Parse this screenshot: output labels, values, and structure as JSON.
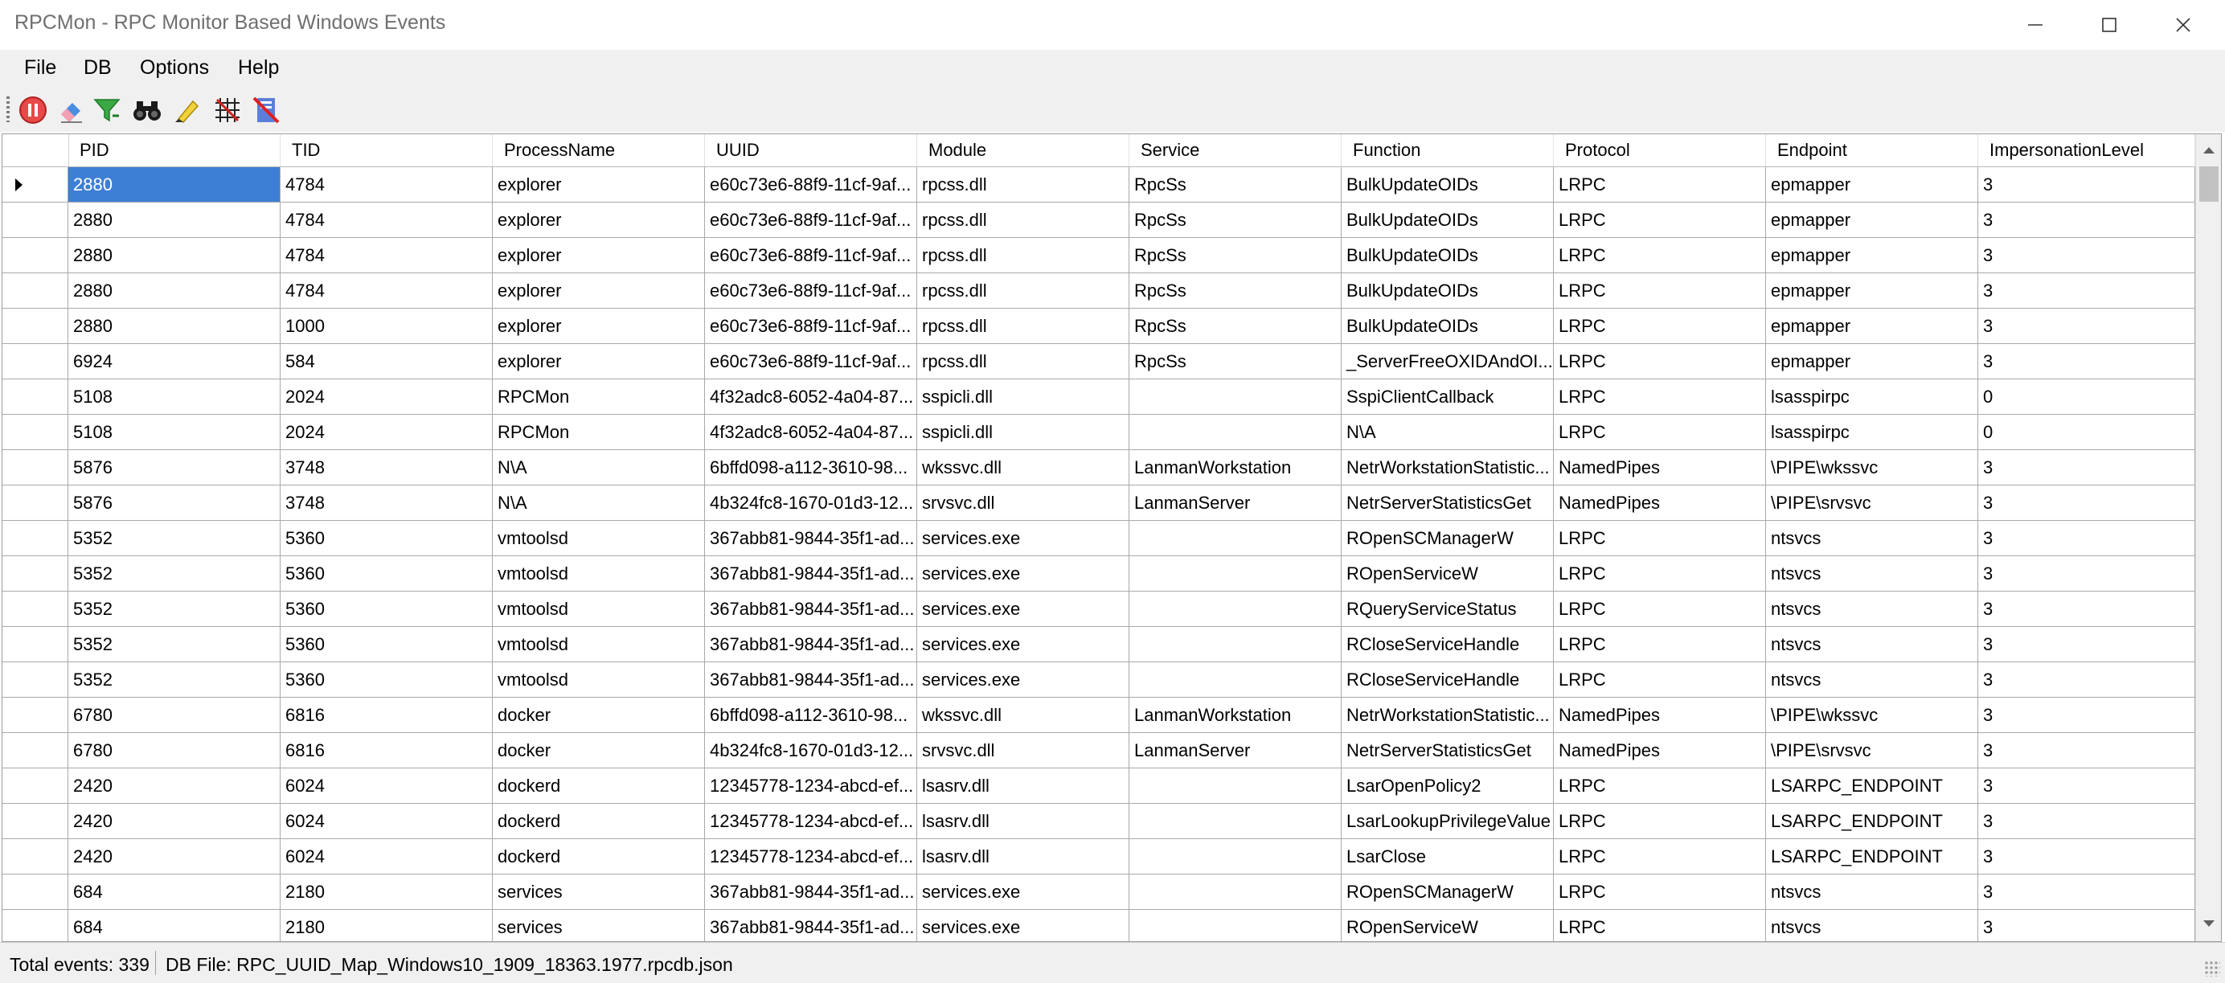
{
  "window": {
    "title": "RPCMon - RPC Monitor Based Windows Events"
  },
  "menu": [
    "File",
    "DB",
    "Options",
    "Help"
  ],
  "toolbar": [
    "stop-icon",
    "eraser-icon",
    "filter-icon",
    "binoculars-icon",
    "highlighter-icon",
    "grid-icon",
    "clear-filter-icon"
  ],
  "grid": {
    "columns": [
      "PID",
      "TID",
      "ProcessName",
      "UUID",
      "Module",
      "Service",
      "Function",
      "Protocol",
      "Endpoint",
      "ImpersonationLevel"
    ],
    "selected_row": 0,
    "rows": [
      [
        "2880",
        "4784",
        "explorer",
        "e60c73e6-88f9-11cf-9af...",
        "rpcss.dll",
        "RpcSs",
        "BulkUpdateOIDs",
        "LRPC",
        "epmapper",
        "3"
      ],
      [
        "2880",
        "4784",
        "explorer",
        "e60c73e6-88f9-11cf-9af...",
        "rpcss.dll",
        "RpcSs",
        "BulkUpdateOIDs",
        "LRPC",
        "epmapper",
        "3"
      ],
      [
        "2880",
        "4784",
        "explorer",
        "e60c73e6-88f9-11cf-9af...",
        "rpcss.dll",
        "RpcSs",
        "BulkUpdateOIDs",
        "LRPC",
        "epmapper",
        "3"
      ],
      [
        "2880",
        "4784",
        "explorer",
        "e60c73e6-88f9-11cf-9af...",
        "rpcss.dll",
        "RpcSs",
        "BulkUpdateOIDs",
        "LRPC",
        "epmapper",
        "3"
      ],
      [
        "2880",
        "1000",
        "explorer",
        "e60c73e6-88f9-11cf-9af...",
        "rpcss.dll",
        "RpcSs",
        "BulkUpdateOIDs",
        "LRPC",
        "epmapper",
        "3"
      ],
      [
        "6924",
        "584",
        "explorer",
        "e60c73e6-88f9-11cf-9af...",
        "rpcss.dll",
        "RpcSs",
        "_ServerFreeOXIDAndOI...",
        "LRPC",
        "epmapper",
        "3"
      ],
      [
        "5108",
        "2024",
        "RPCMon",
        "4f32adc8-6052-4a04-87...",
        "sspicli.dll",
        "",
        "SspiClientCallback",
        "LRPC",
        "lsasspirpc",
        "0"
      ],
      [
        "5108",
        "2024",
        "RPCMon",
        "4f32adc8-6052-4a04-87...",
        "sspicli.dll",
        "",
        "N\\A",
        "LRPC",
        "lsasspirpc",
        "0"
      ],
      [
        "5876",
        "3748",
        "N\\A",
        "6bffd098-a112-3610-98...",
        "wkssvc.dll",
        "LanmanWorkstation",
        "NetrWorkstationStatistic...",
        "NamedPipes",
        "\\PIPE\\wkssvc",
        "3"
      ],
      [
        "5876",
        "3748",
        "N\\A",
        "4b324fc8-1670-01d3-12...",
        "srvsvc.dll",
        "LanmanServer",
        "NetrServerStatisticsGet",
        "NamedPipes",
        "\\PIPE\\srvsvc",
        "3"
      ],
      [
        "5352",
        "5360",
        "vmtoolsd",
        "367abb81-9844-35f1-ad...",
        "services.exe",
        "",
        "ROpenSCManagerW",
        "LRPC",
        "ntsvcs",
        "3"
      ],
      [
        "5352",
        "5360",
        "vmtoolsd",
        "367abb81-9844-35f1-ad...",
        "services.exe",
        "",
        "ROpenServiceW",
        "LRPC",
        "ntsvcs",
        "3"
      ],
      [
        "5352",
        "5360",
        "vmtoolsd",
        "367abb81-9844-35f1-ad...",
        "services.exe",
        "",
        "RQueryServiceStatus",
        "LRPC",
        "ntsvcs",
        "3"
      ],
      [
        "5352",
        "5360",
        "vmtoolsd",
        "367abb81-9844-35f1-ad...",
        "services.exe",
        "",
        "RCloseServiceHandle",
        "LRPC",
        "ntsvcs",
        "3"
      ],
      [
        "5352",
        "5360",
        "vmtoolsd",
        "367abb81-9844-35f1-ad...",
        "services.exe",
        "",
        "RCloseServiceHandle",
        "LRPC",
        "ntsvcs",
        "3"
      ],
      [
        "6780",
        "6816",
        "docker",
        "6bffd098-a112-3610-98...",
        "wkssvc.dll",
        "LanmanWorkstation",
        "NetrWorkstationStatistic...",
        "NamedPipes",
        "\\PIPE\\wkssvc",
        "3"
      ],
      [
        "6780",
        "6816",
        "docker",
        "4b324fc8-1670-01d3-12...",
        "srvsvc.dll",
        "LanmanServer",
        "NetrServerStatisticsGet",
        "NamedPipes",
        "\\PIPE\\srvsvc",
        "3"
      ],
      [
        "2420",
        "6024",
        "dockerd",
        "12345778-1234-abcd-ef...",
        "lsasrv.dll",
        "",
        "LsarOpenPolicy2",
        "LRPC",
        "LSARPC_ENDPOINT",
        "3"
      ],
      [
        "2420",
        "6024",
        "dockerd",
        "12345778-1234-abcd-ef...",
        "lsasrv.dll",
        "",
        "LsarLookupPrivilegeValue",
        "LRPC",
        "LSARPC_ENDPOINT",
        "3"
      ],
      [
        "2420",
        "6024",
        "dockerd",
        "12345778-1234-abcd-ef...",
        "lsasrv.dll",
        "",
        "LsarClose",
        "LRPC",
        "LSARPC_ENDPOINT",
        "3"
      ],
      [
        "684",
        "2180",
        "services",
        "367abb81-9844-35f1-ad...",
        "services.exe",
        "",
        "ROpenSCManagerW",
        "LRPC",
        "ntsvcs",
        "3"
      ],
      [
        "684",
        "2180",
        "services",
        "367abb81-9844-35f1-ad...",
        "services.exe",
        "",
        "ROpenServiceW",
        "LRPC",
        "ntsvcs",
        "3"
      ]
    ]
  },
  "status": {
    "total_events": "Total events: 339",
    "db_file": "DB File: RPC_UUID_Map_Windows10_1909_18363.1977.rpcdb.json"
  }
}
